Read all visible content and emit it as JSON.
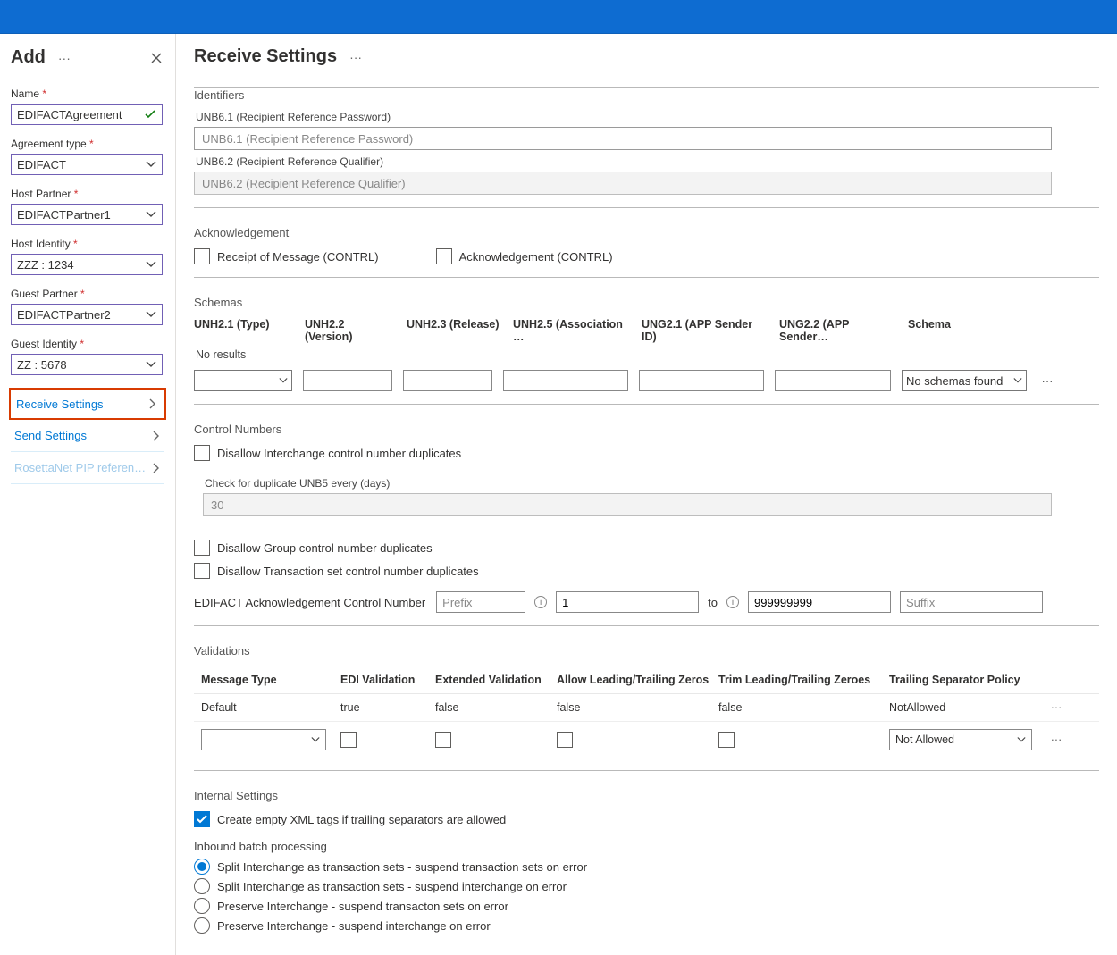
{
  "left": {
    "title": "Add",
    "fields": {
      "name_label": "Name",
      "name_value": "EDIFACTAgreement",
      "agreement_type_label": "Agreement type",
      "agreement_type_value": "EDIFACT",
      "host_partner_label": "Host Partner",
      "host_partner_value": "EDIFACTPartner1",
      "host_identity_label": "Host Identity",
      "host_identity_value": "ZZZ : 1234",
      "guest_partner_label": "Guest Partner",
      "guest_partner_value": "EDIFACTPartner2",
      "guest_identity_label": "Guest Identity",
      "guest_identity_value": "ZZ : 5678"
    },
    "settings": {
      "receive": "Receive Settings",
      "send": "Send Settings",
      "rosetta": "RosettaNet PIP referen…"
    }
  },
  "right": {
    "title": "Receive Settings",
    "identifiers": {
      "section": "Identifiers",
      "unb61_label": "UNB6.1 (Recipient Reference Password)",
      "unb61_placeholder": "UNB6.1 (Recipient Reference Password)",
      "unb62_label": "UNB6.2 (Recipient Reference Qualifier)",
      "unb62_placeholder": "UNB6.2 (Recipient Reference Qualifier)"
    },
    "ack": {
      "section": "Acknowledgement",
      "receipt": "Receipt of Message (CONTRL)",
      "ack": "Acknowledgement (CONTRL)"
    },
    "schemas": {
      "section": "Schemas",
      "cols": {
        "c1": "UNH2.1 (Type)",
        "c2": "UNH2.2 (Version)",
        "c3": "UNH2.3 (Release)",
        "c4": "UNH2.5 (Association …",
        "c5": "UNG2.1 (APP Sender ID)",
        "c6": "UNG2.2 (APP Sender…",
        "c7": "Schema"
      },
      "no_results": "No results",
      "no_schemas": "No schemas found"
    },
    "control": {
      "section": "Control Numbers",
      "disallow_interchange": "Disallow Interchange control number duplicates",
      "dup_label": "Check for duplicate UNB5 every (days)",
      "dup_value": "30",
      "disallow_group": "Disallow Group control number duplicates",
      "disallow_txn": "Disallow Transaction set control number duplicates",
      "edifact_ack_label": "EDIFACT Acknowledgement Control Number",
      "prefix_ph": "Prefix",
      "start_val": "1",
      "to": "to",
      "end_val": "999999999",
      "suffix_ph": "Suffix"
    },
    "validations": {
      "section": "Validations",
      "cols": {
        "msg": "Message Type",
        "edi": "EDI Validation",
        "ext": "Extended Validation",
        "lead": "Allow Leading/Trailing Zeros",
        "trim": "Trim Leading/Trailing Zeroes",
        "trail": "Trailing Separator Policy"
      },
      "row": {
        "msg": "Default",
        "edi": "true",
        "ext": "false",
        "lead": "false",
        "trim": "false",
        "trail": "NotAllowed"
      },
      "not_allowed_select": "Not Allowed"
    },
    "internal": {
      "section": "Internal Settings",
      "create_empty": "Create empty XML tags if trailing separators are allowed",
      "batch_heading": "Inbound batch processing",
      "opts": {
        "o1": "Split Interchange as transaction sets - suspend transaction sets on error",
        "o2": "Split Interchange as transaction sets - suspend interchange on error",
        "o3": "Preserve Interchange - suspend transacton sets on error",
        "o4": "Preserve Interchange - suspend interchange on error"
      }
    }
  }
}
